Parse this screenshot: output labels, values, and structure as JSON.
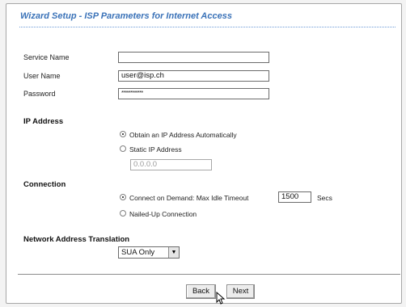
{
  "title": "Wizard Setup - ISP Parameters for Internet Access",
  "service_name": {
    "label": "Service Name",
    "value": ""
  },
  "user_name": {
    "label": "User Name",
    "value": "user@isp.ch"
  },
  "password": {
    "label": "Password",
    "value": "************"
  },
  "ip_address": {
    "heading": "IP Address",
    "options": [
      {
        "label": "Obtain an IP Address Automatically",
        "selected": true
      },
      {
        "label": "Static IP Address",
        "selected": false
      }
    ],
    "static_value": "0.0.0.0"
  },
  "connection": {
    "heading": "Connection",
    "on_demand_label": "Connect on Demand: Max Idle Timeout",
    "timeout_value": "1500",
    "timeout_unit": "Secs",
    "nailed_up_label": "Nailed-Up Connection",
    "on_demand_selected": true
  },
  "nat": {
    "heading": "Network Address Translation",
    "value": "SUA Only"
  },
  "buttons": {
    "back": "Back",
    "next": "Next"
  },
  "colors": {
    "title": "#3a72b8",
    "frame_border": "#a7a7a7"
  }
}
